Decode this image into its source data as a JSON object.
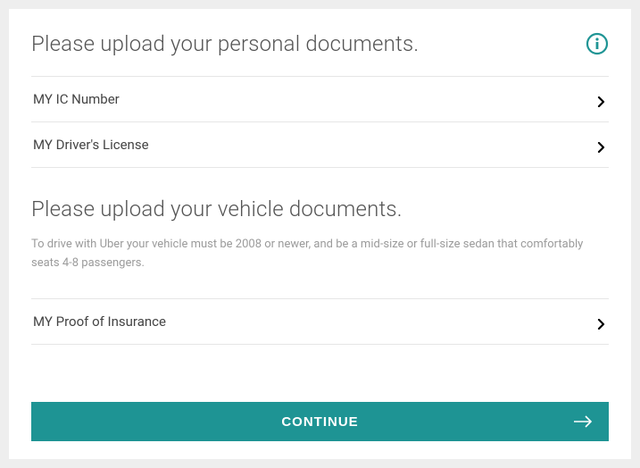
{
  "colors": {
    "accent": "#1e9494"
  },
  "personal": {
    "title": "Please upload your personal documents.",
    "items": [
      {
        "label": "MY IC Number"
      },
      {
        "label": "MY Driver's License"
      }
    ]
  },
  "vehicle": {
    "title": "Please upload your vehicle documents.",
    "subtext": "To drive with Uber your vehicle must be 2008 or newer, and be a mid-size or full-size sedan that comfortably seats 4-8 passengers.",
    "items": [
      {
        "label": "MY Proof of Insurance"
      }
    ]
  },
  "continue_label": "CONTINUE"
}
